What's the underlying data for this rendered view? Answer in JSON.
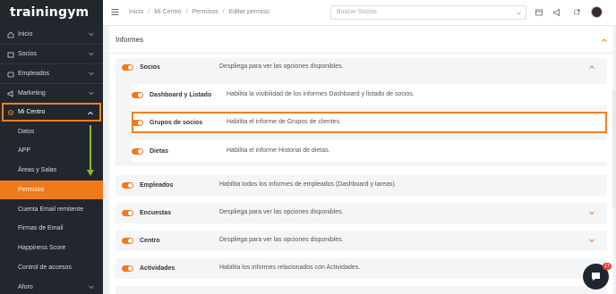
{
  "app": {
    "logo_text": "trainingym"
  },
  "sidebar": {
    "items": [
      {
        "label": "Inicio",
        "icon": "home-icon",
        "expandable": true
      },
      {
        "label": "Socios",
        "icon": "socios-icon",
        "expandable": true
      },
      {
        "label": "Empleados",
        "icon": "employees-icon",
        "expandable": true
      },
      {
        "label": "Marketing",
        "icon": "megaphone-icon",
        "expandable": true
      },
      {
        "label": "Mi Centro",
        "icon": "settings-icon",
        "expandable": true,
        "expanded": true
      }
    ],
    "subitems": [
      {
        "label": "Datos"
      },
      {
        "label": "APP"
      },
      {
        "label": "Áreas y Salas"
      },
      {
        "label": "Permisos",
        "selected": true
      },
      {
        "label": "Cuenta Email remitente"
      },
      {
        "label": "Firmas de Email"
      },
      {
        "label": "Happiness Score"
      },
      {
        "label": "Control de accesos"
      },
      {
        "label": "Aforo",
        "expandable": true
      }
    ]
  },
  "topbar": {
    "breadcrumbs": [
      "Inicio",
      "Mi Centro",
      "Permisos",
      "Editar permiso"
    ],
    "search_placeholder": "Buscar Socios",
    "notification_count": "17"
  },
  "informes": {
    "title": "Informes",
    "groups": [
      {
        "title": "Socios",
        "description": "Despliega para ver las opciones disponibles.",
        "expanded": true,
        "enabled": true,
        "children": [
          {
            "title": "Dashboard y Listado",
            "description": "Habilita la visibilidad de los informes Dashboard y listado de socios.",
            "enabled": true
          },
          {
            "title": "Grupos de socios",
            "description": "Habilita el informe de Grupos de clientes.",
            "enabled": true,
            "highlighted": true
          },
          {
            "title": "Dietas",
            "description": "Habilita el informe Historial de dietas.",
            "enabled": true
          }
        ]
      },
      {
        "title": "Empleados",
        "description": "Habilita todos los informes de empleados (Dashboard y tareas).",
        "enabled": true
      },
      {
        "title": "Encuestas",
        "description": "Despliega para ver las opciones disponibles.",
        "enabled": true,
        "expandable": true
      },
      {
        "title": "Centro",
        "description": "Despliega para ver las opciones disponibles.",
        "enabled": true,
        "expandable": true
      },
      {
        "title": "Actividades",
        "description": "Habilita los informes relacionados con Actividades.",
        "enabled": true
      }
    ]
  },
  "colors": {
    "accent": "#f07a1a",
    "sidebar_bg": "#22272e",
    "arrow": "#8fb823"
  }
}
